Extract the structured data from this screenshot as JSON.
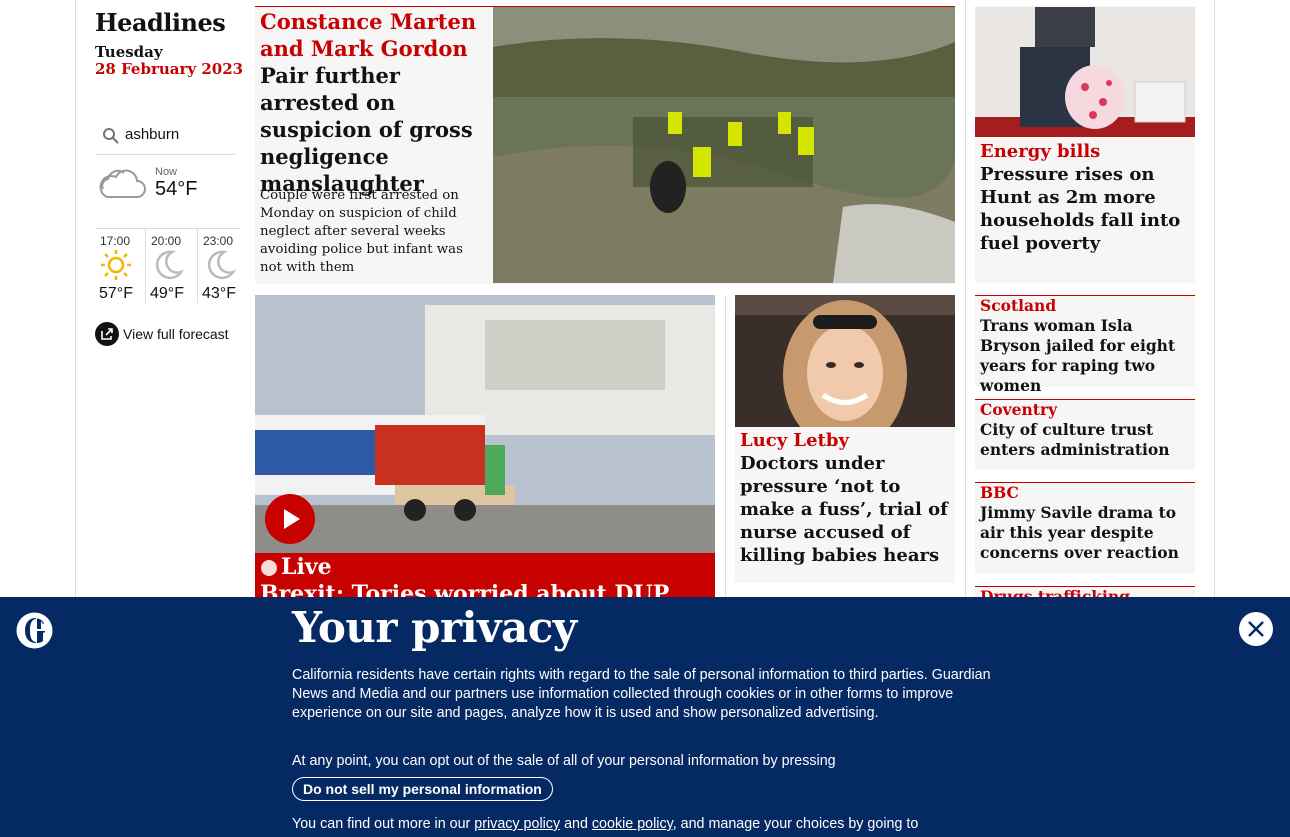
{
  "sidebar": {
    "title": "Headlines",
    "day": "Tuesday",
    "date": "28 February 2023",
    "search_value": "ashburn",
    "now_label": "Now",
    "now_temp": "54°F",
    "hourly": [
      {
        "time": "17:00",
        "temp": "57°F",
        "icon": "sun-icon"
      },
      {
        "time": "20:00",
        "temp": "49°F",
        "icon": "moon-icon"
      },
      {
        "time": "23:00",
        "temp": "43°F",
        "icon": "moon-icon"
      }
    ],
    "forecast_link": "View full forecast"
  },
  "lead": {
    "kicker": "Constance Marten and Mark Gordon",
    "headline": "Pair further arrested on suspicion of gross negligence manslaughter",
    "standfirst": "Couple were first arrested on Monday on suspicion of child neglect after several weeks avoiding police but infant was not with them"
  },
  "energy": {
    "kicker": "Energy bills",
    "headline": "Pressure rises on Hunt as 2m more households fall into fuel poverty"
  },
  "brexit": {
    "live_label": "Live",
    "headline": "Brexit: Tories worried about DUP"
  },
  "letby": {
    "kicker": "Lucy Letby",
    "headline": "Doctors under pressure ‘not to make a fuss’, trial of nurse accused of killing babies hears"
  },
  "right_stories": [
    {
      "kicker": "Scotland",
      "headline": "Trans woman Isla Bryson jailed for eight years for raping two women"
    },
    {
      "kicker": "Coventry",
      "headline": "City of culture trust enters administration"
    },
    {
      "kicker": "BBC",
      "headline": "Jimmy Savile drama to air this year despite concerns over reaction"
    },
    {
      "kicker": "Drugs trafficking",
      "headline": ""
    }
  ],
  "privacy": {
    "title": "Your privacy",
    "paragraph1": "California residents have certain rights with regard to the sale of personal information to third parties. Guardian News and Media and our partners use information collected through cookies or in other forms to improve experience on our site and pages, analyze how it is used and show personalized advertising.",
    "paragraph2": "At any point, you can opt out of the sale of all of your personal information by pressing",
    "button": "Do not sell my personal information",
    "p3_prefix": "You can find out more in our ",
    "privacy_link": "privacy policy",
    "p3_and": " and ",
    "cookie_link": "cookie policy",
    "p3_suffix": ", and manage your choices by going to"
  },
  "colors": {
    "news_red": "#c70000",
    "overlay_blue": "#052962",
    "card_grey": "#f6f6f6"
  }
}
